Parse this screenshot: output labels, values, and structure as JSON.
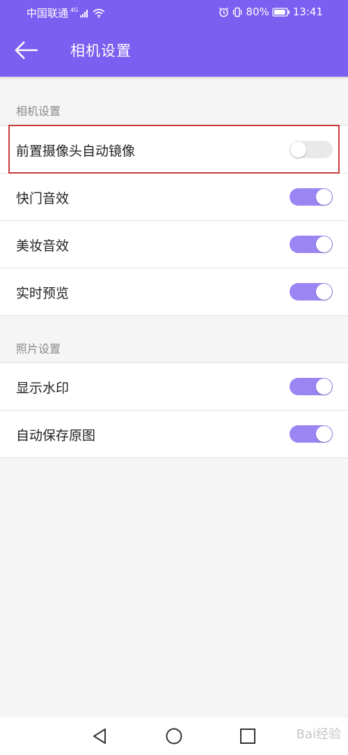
{
  "status_bar": {
    "carrier": "中国联通",
    "network_tag": "4G",
    "battery": "80%",
    "time": "13:41"
  },
  "app_bar": {
    "title": "相机设置",
    "back_icon": "arrow-left-icon"
  },
  "sections": [
    {
      "header": "相机设置",
      "items": [
        {
          "label": "前置摄像头自动镜像",
          "enabled": false
        },
        {
          "label": "快门音效",
          "enabled": true
        },
        {
          "label": "美妆音效",
          "enabled": true
        },
        {
          "label": "实时预览",
          "enabled": true
        }
      ]
    },
    {
      "header": "照片设置",
      "items": [
        {
          "label": "显示水印",
          "enabled": true
        },
        {
          "label": "自动保存原图",
          "enabled": true
        }
      ]
    }
  ],
  "nav_bar": {
    "back": "triangle-back-icon",
    "home": "circle-home-icon",
    "recents": "square-recents-icon"
  },
  "watermark": "Bai经验",
  "colors": {
    "accent": "#7b5ff0",
    "toggle_on": "#9a85f3",
    "toggle_off": "#e9e9e9",
    "highlight": "#c8393b"
  }
}
